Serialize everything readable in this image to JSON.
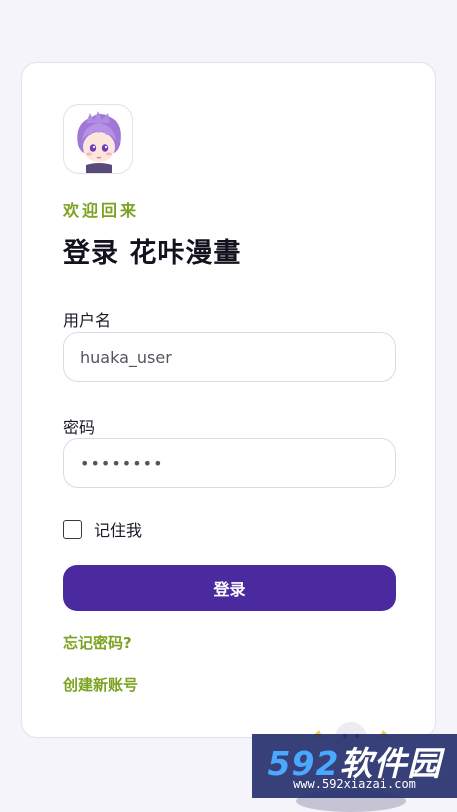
{
  "header": {
    "greeting": "欢迎回来",
    "title": "登录 花咔漫畫"
  },
  "form": {
    "username_label": "用户名",
    "username_value": "huaka_user",
    "password_label": "密码",
    "password_value": "password",
    "remember_label": "记住我",
    "remember_checked": false,
    "submit_label": "登录"
  },
  "links": {
    "forgot_password": "忘记密码?",
    "create_account": "创建新账号"
  },
  "watermark": {
    "brand_number": "592",
    "brand_name": "软件园",
    "url": "www.592xiazai.com"
  },
  "colors": {
    "accent_green": "#7ca221",
    "primary_purple": "#4a2a9e",
    "background": "#f5f4fb"
  },
  "icons": {
    "avatar": "anime-avatar-purple-hair"
  }
}
